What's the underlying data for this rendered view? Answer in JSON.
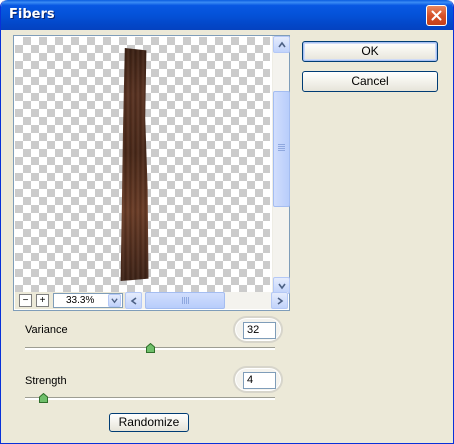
{
  "window": {
    "title": "Fibers"
  },
  "preview": {
    "zoom_value": "33.3%",
    "zoom_out_label": "−",
    "zoom_in_label": "+"
  },
  "buttons": {
    "ok": "OK",
    "cancel": "Cancel",
    "randomize": "Randomize"
  },
  "variance": {
    "label": "Variance",
    "value": "32",
    "slider_fraction": 0.5
  },
  "strength": {
    "label": "Strength",
    "value": "4",
    "slider_fraction": 0.07
  },
  "colors": {
    "title_bar": "#0452d8",
    "window_bg": "#ece9d8",
    "fiber": "#5a3322"
  },
  "icons": {
    "close": "close-icon",
    "slider_thumb": "slider-thumb-icon"
  }
}
